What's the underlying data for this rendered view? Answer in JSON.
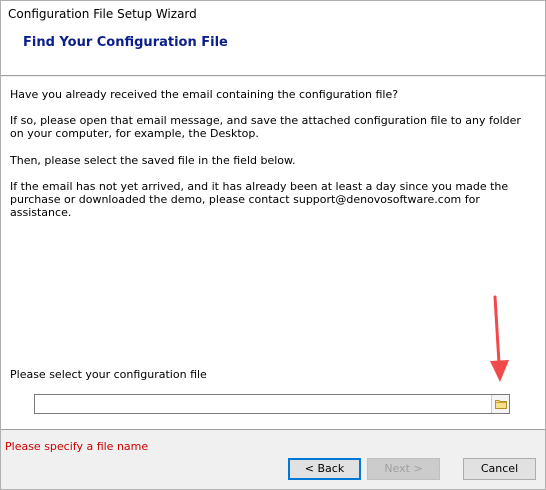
{
  "window": {
    "title": "Configuration File Setup Wizard"
  },
  "header": {
    "page_title": "Find Your Configuration File"
  },
  "content": {
    "paragraphs": [
      "Have you already received the email containing the configuration file?",
      "If so, please open that email message, and save the attached configuration file to any folder on your computer, for example, the Desktop.",
      "Then, please select the saved file in the field below.",
      "If the email has not yet arrived, and it has already been at least a day since you made the purchase or downloaded the demo, please contact support@denovosoftware.com for assistance."
    ],
    "select_label": "Please select your configuration file",
    "file_input": {
      "value": "",
      "placeholder": ""
    },
    "browse_icon": "folder-icon"
  },
  "annotation": {
    "arrow_color": "#f04a4a"
  },
  "footer": {
    "error_message": "Please specify a file name",
    "back_label": "< Back",
    "next_label": "Next >",
    "cancel_label": "Cancel"
  },
  "colors": {
    "title_blue": "#0a1e8c",
    "error_red": "#cc0000",
    "focus_blue": "#0078d7"
  }
}
